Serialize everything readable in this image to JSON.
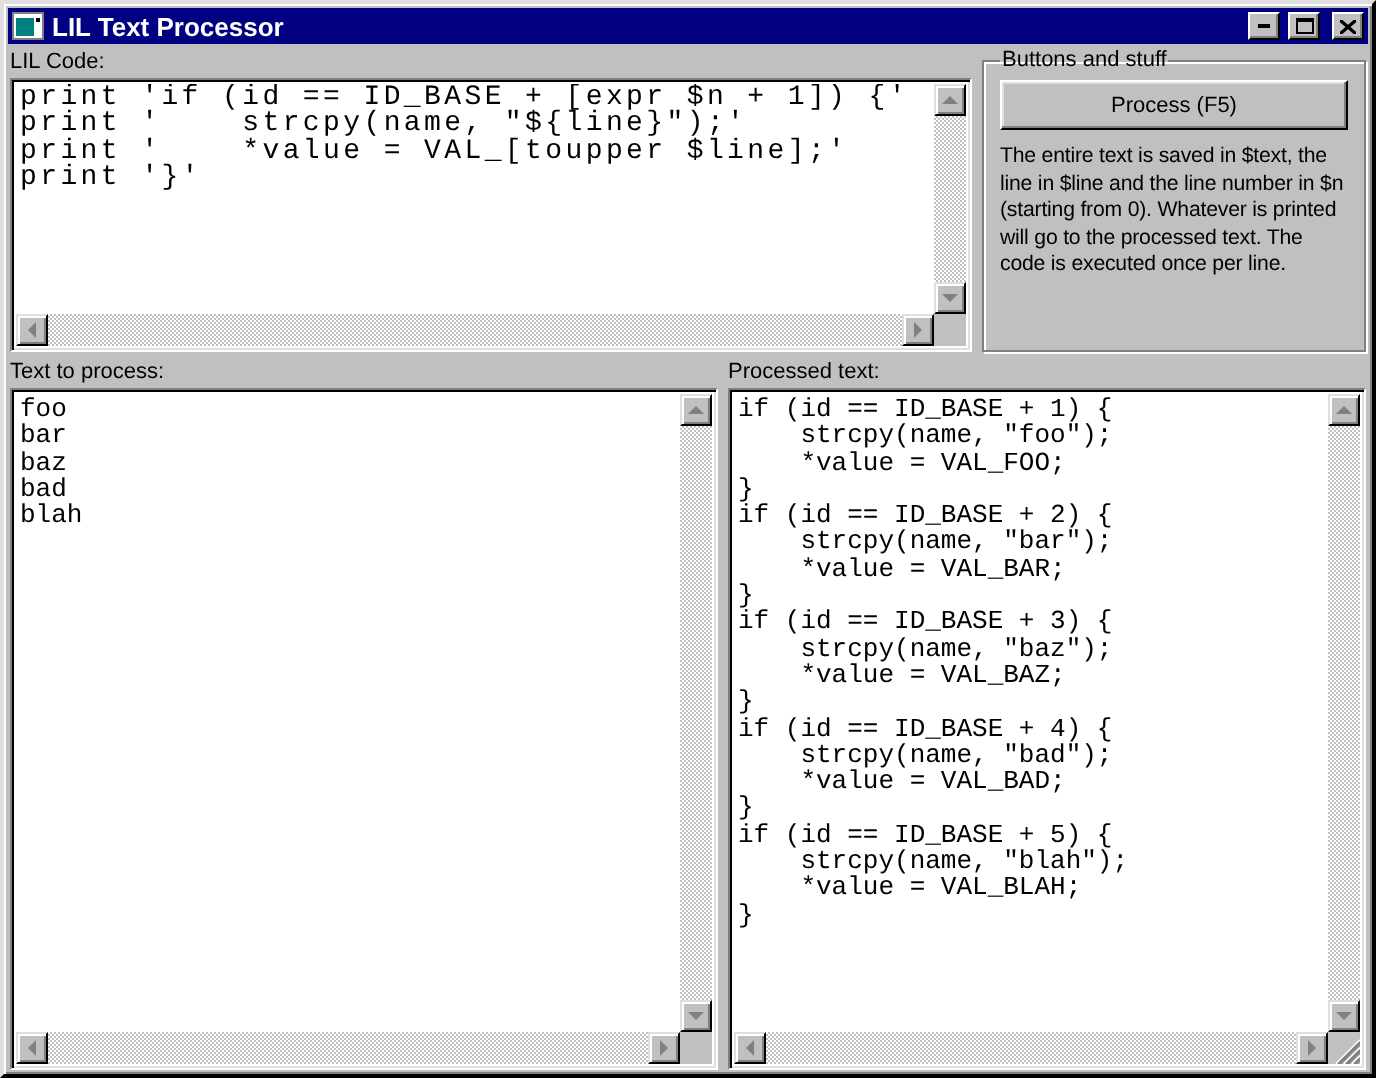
{
  "window": {
    "title": "LIL Text Processor"
  },
  "code_editor": {
    "label": "LIL Code:",
    "lines": [
      "print 'if (id == ID_BASE + [expr $n + 1]) {'",
      "print '    strcpy(name, \"${line}\");'",
      "print '    *value = VAL_[toupper $line];'",
      "print '}'"
    ]
  },
  "group": {
    "title": "Buttons and stuff",
    "button": "Process (F5)",
    "description": "The entire text is saved in $text, the line in $line and the line number in $n (starting from 0). Whatever is printed will go to the processed text. The code is executed once per line."
  },
  "input_pane": {
    "label": "Text to process:",
    "lines": [
      "foo",
      "bar",
      "baz",
      "bad",
      "blah"
    ]
  },
  "output_pane": {
    "label": "Processed text:",
    "lines": [
      "if (id == ID_BASE + 1) {",
      "    strcpy(name, \"foo\");",
      "    *value = VAL_FOO;",
      "}",
      "if (id == ID_BASE + 2) {",
      "    strcpy(name, \"bar\");",
      "    *value = VAL_BAR;",
      "}",
      "if (id == ID_BASE + 3) {",
      "    strcpy(name, \"baz\");",
      "    *value = VAL_BAZ;",
      "}",
      "if (id == ID_BASE + 4) {",
      "    strcpy(name, \"bad\");",
      "    *value = VAL_BAD;",
      "}",
      "if (id == ID_BASE + 5) {",
      "    strcpy(name, \"blah\");",
      "    *value = VAL_BLAH;",
      "}"
    ]
  }
}
